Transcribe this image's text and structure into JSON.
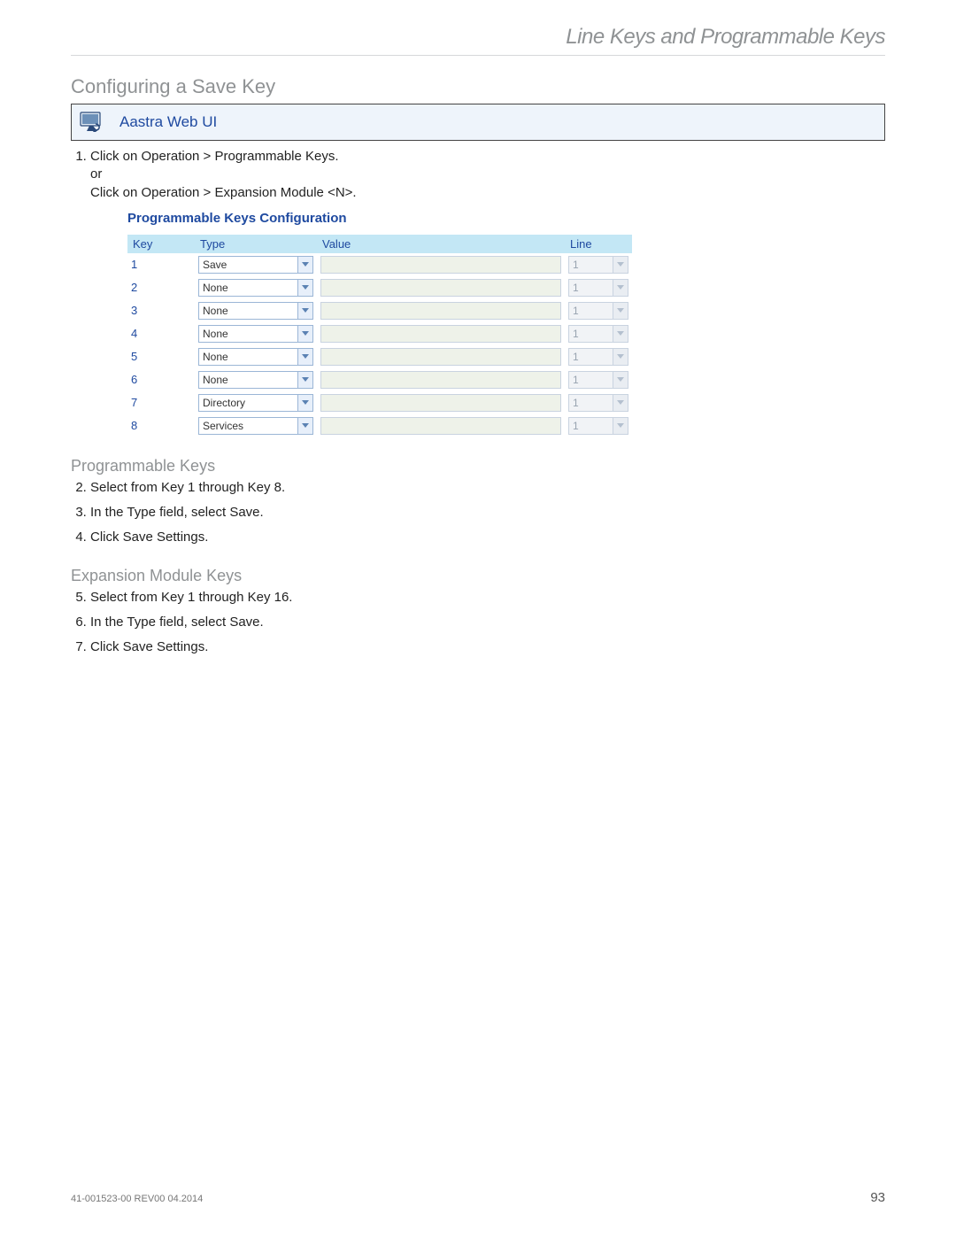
{
  "header": {
    "chapter": "Line Keys and Programmable Keys"
  },
  "section": {
    "title": "Configuring a Save Key"
  },
  "webui_bar": {
    "label": "Aastra Web UI"
  },
  "step1": {
    "line1": "Click on Operation > Programmable Keys.",
    "or": "or",
    "line2": "Click on Operation > Expansion Module <N>."
  },
  "config": {
    "title": "Programmable Keys Configuration",
    "columns": {
      "key": "Key",
      "type": "Type",
      "value": "Value",
      "line": "Line"
    },
    "rows": [
      {
        "key": "1",
        "type": "Save",
        "line": "1",
        "value": ""
      },
      {
        "key": "2",
        "type": "None",
        "line": "1",
        "value": ""
      },
      {
        "key": "3",
        "type": "None",
        "line": "1",
        "value": ""
      },
      {
        "key": "4",
        "type": "None",
        "line": "1",
        "value": ""
      },
      {
        "key": "5",
        "type": "None",
        "line": "1",
        "value": ""
      },
      {
        "key": "6",
        "type": "None",
        "line": "1",
        "value": ""
      },
      {
        "key": "7",
        "type": "Directory",
        "line": "1",
        "value": ""
      },
      {
        "key": "8",
        "type": "Services",
        "line": "1",
        "value": ""
      }
    ]
  },
  "subheadings": {
    "prog": "Programmable Keys",
    "exp": "Expansion Module Keys"
  },
  "steps_prog": {
    "s2": "Select from Key 1 through Key 8.",
    "s3": "In the Type field, select Save.",
    "s4": "Click Save Settings."
  },
  "steps_exp": {
    "s5": "Select from Key 1 through Key 16.",
    "s6": "In the Type field, select Save.",
    "s7": "Click Save Settings."
  },
  "footer": {
    "rev": "41-001523-00 REV00   04.2014",
    "page": "93"
  }
}
